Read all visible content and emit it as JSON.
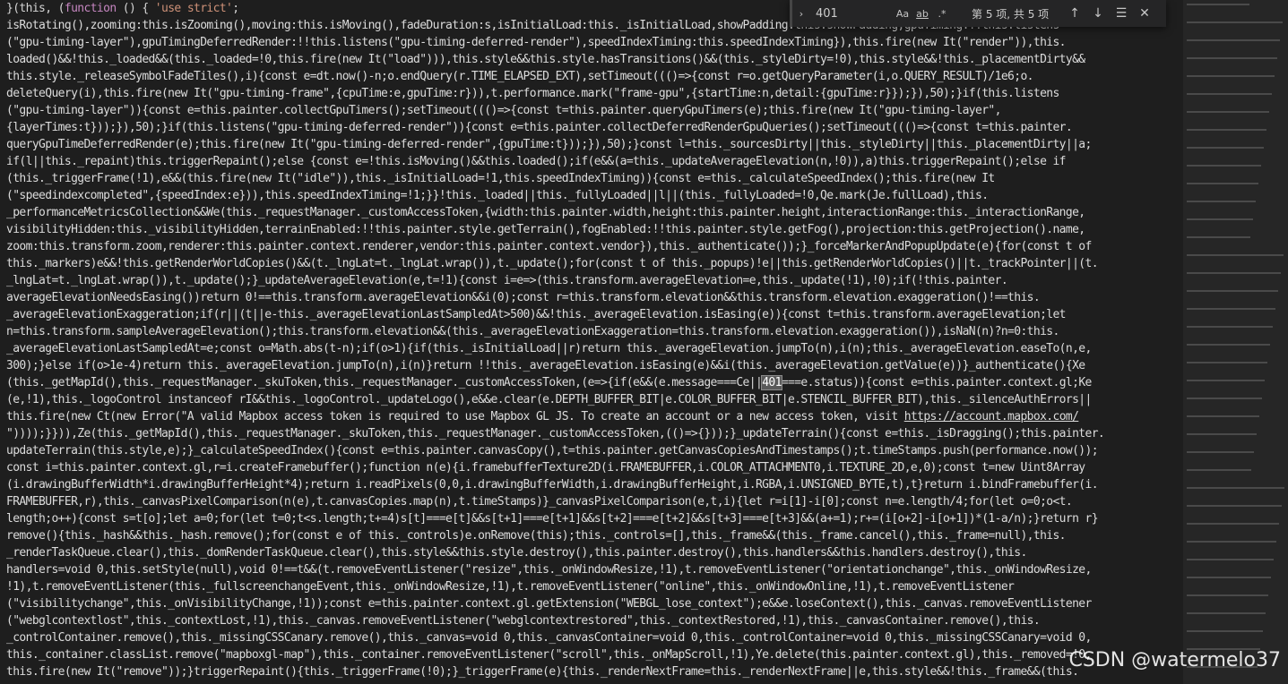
{
  "editor": {
    "first_line": {
      "p1": "}(this, (",
      "p2": "function",
      "p3": " () { ",
      "p4": "'use strict'",
      "p5": ";"
    },
    "lines": [
      "isRotating(),zooming:this.isZooming(),moving:this.isMoving(),fadeDuration:s,isInitialLoad:this._isInitialLoad,showPadding:this.showPadding,gpuTiming:!!this.listens",
      "(\"gpu-timing-layer\"),gpuTimingDeferredRender:!!this.listens(\"gpu-timing-deferred-render\"),speedIndexTiming:this.speedIndexTiming}),this.fire(new It(\"render\")),this.",
      "loaded()&&!this._loaded&&(this._loaded=!0,this.fire(new It(\"load\"))),this.style&&this.style.hasTransitions()&&(this._styleDirty=!0),this.style&&!this._placementDirty&&",
      "this.style._releaseSymbolFadeTiles(),i){const e=dt.now()-n;o.endQuery(r.TIME_ELAPSED_EXT),setTimeout((()=>{const r=o.getQueryParameter(i,o.QUERY_RESULT)/1e6;o.",
      "deleteQuery(i),this.fire(new It(\"gpu-timing-frame\",{cpuTime:e,gpuTime:r})),t.performance.mark(\"frame-gpu\",{startTime:n,detail:{gpuTime:r}});}),50);}if(this.listens",
      "(\"gpu-timing-layer\")){const e=this.painter.collectGpuTimers();setTimeout((()=>{const t=this.painter.queryGpuTimers(e);this.fire(new It(\"gpu-timing-layer\",",
      "{layerTimes:t}));}),50);}if(this.listens(\"gpu-timing-deferred-render\")){const e=this.painter.collectDeferredRenderGpuQueries();setTimeout((()=>{const t=this.painter.",
      "queryGpuTimeDeferredRender(e);this.fire(new It(\"gpu-timing-deferred-render\",{gpuTime:t}));}),50);}const l=this._sourcesDirty||this._styleDirty||this._placementDirty||a;",
      "if(l||this._repaint)this.triggerRepaint();else {const e=!this.isMoving()&&this.loaded();if(e&&(a=this._updateAverageElevation(n,!0)),a)this.triggerRepaint();else if",
      "(this._triggerFrame(!1),e&&(this.fire(new It(\"idle\")),this._isInitialLoad=!1,this.speedIndexTiming)){const e=this._calculateSpeedIndex();this.fire(new It",
      "(\"speedindexcompleted\",{speedIndex:e})),this.speedIndexTiming=!1;}}!this._loaded||this._fullyLoaded||l||(this._fullyLoaded=!0,Qe.mark(Je.fullLoad),this.",
      "_performanceMetricsCollection&&We(this._requestManager._customAccessToken,{width:this.painter.width,height:this.painter.height,interactionRange:this._interactionRange,",
      "visibilityHidden:this._visibilityHidden,terrainEnabled:!!this.painter.style.getTerrain(),fogEnabled:!!this.painter.style.getFog(),projection:this.getProjection().name,",
      "zoom:this.transform.zoom,renderer:this.painter.context.renderer,vendor:this.painter.context.vendor}),this._authenticate());}_forceMarkerAndPopupUpdate(e){for(const t of",
      "this._markers)e&&!this.getRenderWorldCopies()&&(t._lngLat=t._lngLat.wrap()),t._update();for(const t of this._popups)!e||this.getRenderWorldCopies()||t._trackPointer||(t.",
      "_lngLat=t._lngLat.wrap()),t._update();}_updateAverageElevation(e,t=!1){const i=e=>(this.transform.averageElevation=e,this._update(!1),!0);if(!this.painter.",
      "averageElevationNeedsEasing())return 0!==this.transform.averageElevation&&i(0);const r=this.transform.elevation&&this.transform.elevation.exaggeration()!==this.",
      "_averageElevationExaggeration;if(r||(t||e-this._averageElevationLastSampledAt>500)&&!this._averageElevation.isEasing(e)){const t=this.transform.averageElevation;let",
      "n=this.transform.sampleAverageElevation();this.transform.elevation&&(this._averageElevationExaggeration=this.transform.elevation.exaggeration()),isNaN(n)?n=0:this.",
      "_averageElevationLastSampledAt=e;const o=Math.abs(t-n);if(o>1){if(this._isInitialLoad||r)return this._averageElevation.jumpTo(n),i(n);this._averageElevation.easeTo(n,e,",
      "300);}else if(o>1e-4)return this._averageElevation.jumpTo(n),i(n)}return !!this._averageElevation.isEasing(e)&&i(this._averageElevation.getValue(e))}_authenticate(){Xe",
      "(this._getMapId(),this._requestManager._skuToken,this._requestManager._customAccessToken,(e=>{if(e&&(e.message===Ce||",
      "(e,!1),this._logoControl instanceof rI&&this._logoControl._updateLogo(),e&&e.clear(e.DEPTH_BUFFER_BIT|e.COLOR_BUFFER_BIT|e.STENCIL_BUFFER_BIT),this._silenceAuthErrors||",
      "this.fire(new Ct(new Error(\"A valid Mapbox access token is required to use Mapbox GL JS. To create an account or a new access token, visit ",
      "\"))));}})),Ze(this._getMapId(),this._requestManager._skuToken,this._requestManager._customAccessToken,(()=>{}));}_updateTerrain(){const e=this._isDragging();this.painter.",
      "updateTerrain(this.style,e);}_calculateSpeedIndex(){const e=this.painter.canvasCopy(),t=this.painter.getCanvasCopiesAndTimestamps();t.timeStamps.push(performance.now());",
      "const i=this.painter.context.gl,r=i.createFramebuffer();function n(e){i.framebufferTexture2D(i.FRAMEBUFFER,i.COLOR_ATTACHMENT0,i.TEXTURE_2D,e,0);const t=new Uint8Array",
      "(i.drawingBufferWidth*i.drawingBufferHeight*4);return i.readPixels(0,0,i.drawingBufferWidth,i.drawingBufferHeight,i.RGBA,i.UNSIGNED_BYTE,t),t}return i.bindFramebuffer(i.",
      "FRAMEBUFFER,r),this._canvasPixelComparison(n(e),t.canvasCopies.map(n),t.timeStamps)}_canvasPixelComparison(e,t,i){let r=i[1]-i[0];const n=e.length/4;for(let o=0;o<t.",
      "length;o++){const s=t[o];let a=0;for(let t=0;t<s.length;t+=4)s[t]===e[t]&&s[t+1]===e[t+1]&&s[t+2]===e[t+2]&&s[t+3]===e[t+3]&&(a+=1);r+=(i[o+2]-i[o+1])*(1-a/n);}return r}",
      "remove(){this._hash&&this._hash.remove();for(const e of this._controls)e.onRemove(this);this._controls=[],this._frame&&(this._frame.cancel(),this._frame=null),this.",
      "_renderTaskQueue.clear(),this._domRenderTaskQueue.clear(),this.style&&this.style.destroy(),this.painter.destroy(),this.handlers&&this.handlers.destroy(),this.",
      "handlers=void 0,this.setStyle(null),void 0!==t&&(t.removeEventListener(\"resize\",this._onWindowResize,!1),t.removeEventListener(\"orientationchange\",this._onWindowResize,",
      "!1),t.removeEventListener(this._fullscreenchangeEvent,this._onWindowResize,!1),t.removeEventListener(\"online\",this._onWindowOnline,!1),t.removeEventListener",
      "(\"visibilitychange\",this._onVisibilityChange,!1));const e=this.painter.context.gl.getExtension(\"WEBGL_lose_context\");e&&e.loseContext(),this._canvas.removeEventListener",
      "(\"webglcontextlost\",this._contextLost,!1),this._canvas.removeEventListener(\"webglcontextrestored\",this._contextRestored,!1),this._canvasContainer.remove(),this.",
      "_controlContainer.remove(),this._missingCSSCanary.remove(),this._canvas=void 0,this._canvasContainer=void 0,this._controlContainer=void 0,this._missingCSSCanary=void 0,",
      "this._container.classList.remove(\"mapboxgl-map\"),this._container.removeEventListener(\"scroll\",this._onMapScroll,!1),Ye.delete(this.painter.context.gl),this._removed=!0,",
      "this.fire(new It(\"remove\"));}triggerRepaint(){this._triggerFrame(!0);}_triggerFrame(e){this._renderNextFrame=this._renderNextFrame||e,this.style&&!this._frame&&(this."
    ],
    "highlight_prefix": "(this._getMapId(),this._requestManager._skuToken,this._requestManager._customAccessToken,(e=>{if(e&&(e.message===Ce||",
    "highlight_match": "401",
    "highlight_suffix": "===e.status)){const e=this.painter.context.gl;Ke",
    "link_prefix": "this.fire(new Ct(new Error(\"A valid Mapbox access token is required to use Mapbox GL JS. To create an account or a new access token, visit ",
    "link_text": "https://account.mapbox.com/"
  },
  "find_widget": {
    "query": "401",
    "match_case_label": "Aa",
    "whole_word_label": "ab",
    "regex_label": ".*",
    "result_text": "第 5 项, 共 5 项",
    "prev_icon": "↑",
    "next_icon": "↓",
    "selection_icon": "☰",
    "close_icon": "✕",
    "toggle_icon": "›"
  },
  "watermark": "CSDN @watermelo37"
}
